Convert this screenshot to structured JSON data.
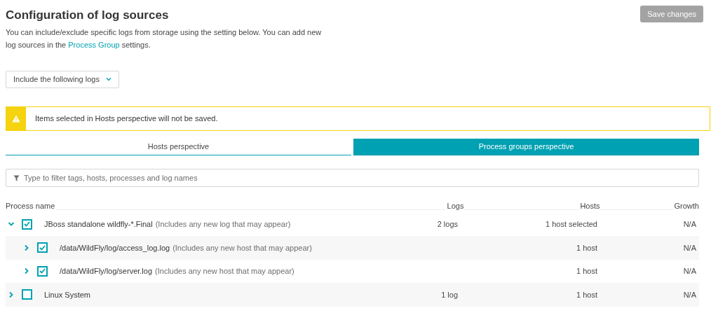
{
  "header": {
    "title": "Configuration of log sources",
    "save_button": {
      "label": "Save changes",
      "disabled": true
    }
  },
  "description": {
    "text_before": "You can include/exclude specific logs from storage using the setting below. You can add new log sources in the",
    "link": "Process Group",
    "text_after": "settings."
  },
  "mode_dropdown": {
    "value": "Include the following logs"
  },
  "warning": {
    "text": "Items selected in Hosts perspective will not be saved."
  },
  "tabs": [
    {
      "label": "Hosts perspective",
      "selected": false
    },
    {
      "label": "Process groups perspective",
      "selected": true
    }
  ],
  "filter": {
    "placeholder": "Type to filter tags, hosts, processes and log names"
  },
  "table": {
    "columns": [
      "Process name",
      "Logs",
      "Hosts",
      "Growth"
    ],
    "rows": [
      {
        "name": "JBoss standalone wildfly-*.Final",
        "note": "(Includes any new log that may appear)",
        "checked": true,
        "expanded": true,
        "logs": "2 logs",
        "hosts": "1 host selected",
        "growth": "N/A",
        "children": [
          {
            "name": "/data/WildFly/log/access_log.log",
            "note": "(Includes any new host that may appear)",
            "checked": true,
            "expanded": false,
            "hosts": "1 host",
            "growth": "N/A"
          },
          {
            "name": "/data/WildFly/log/server.log",
            "note": "(Includes any new host that may appear)",
            "checked": true,
            "expanded": false,
            "hosts": "1 host",
            "growth": "N/A"
          }
        ]
      },
      {
        "name": "Linux System",
        "checked": false,
        "expanded": false,
        "logs": "1 log",
        "hosts": "1 host",
        "growth": "N/A"
      }
    ]
  }
}
